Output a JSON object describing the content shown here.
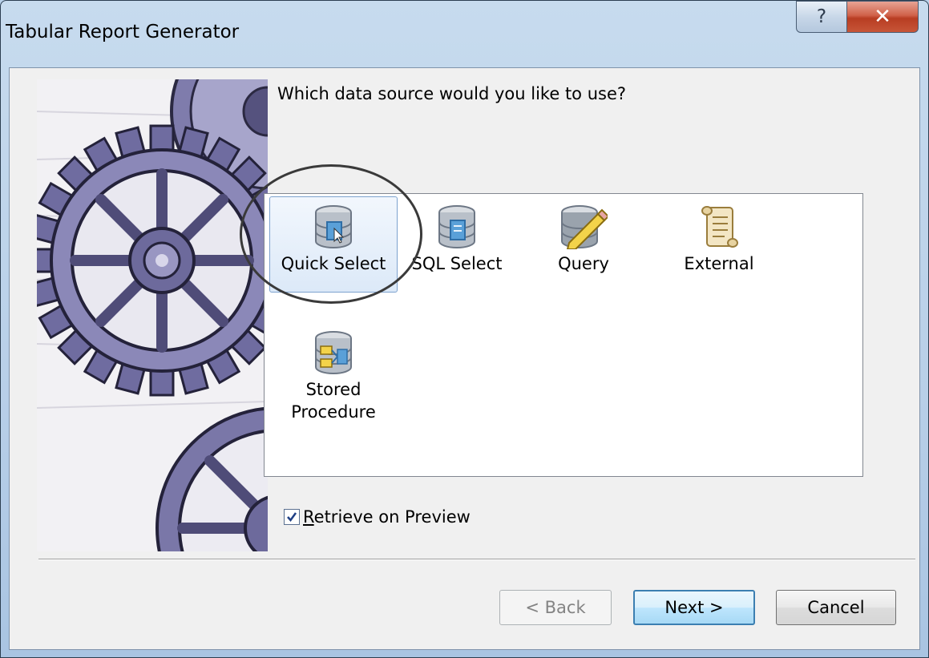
{
  "window": {
    "title": "Tabular Report Generator",
    "help_glyph": "?",
    "close_glyph": "✕"
  },
  "wizard": {
    "question": "Which data source would you like to use?",
    "sources": [
      {
        "label": "Quick Select",
        "icon": "database-cursor-icon",
        "selected": true
      },
      {
        "label": "SQL Select",
        "icon": "database-document-icon",
        "selected": false
      },
      {
        "label": "Query",
        "icon": "database-pencil-icon",
        "selected": false
      },
      {
        "label": "External",
        "icon": "scroll-icon",
        "selected": false
      },
      {
        "label": "Stored Procedure",
        "label_line1": "Stored",
        "label_line2": "Procedure",
        "icon": "database-procedure-icon",
        "selected": false
      }
    ],
    "retrieve_on_preview": {
      "label_mnemonic": "R",
      "label_rest": "etrieve on Preview",
      "checked": true
    }
  },
  "buttons": {
    "back": "< Back",
    "next": "Next >",
    "cancel": "Cancel"
  },
  "colors": {
    "selection_border": "#7da2ce",
    "gear_tint": "#7b78a8",
    "close_red": "#c75538"
  }
}
